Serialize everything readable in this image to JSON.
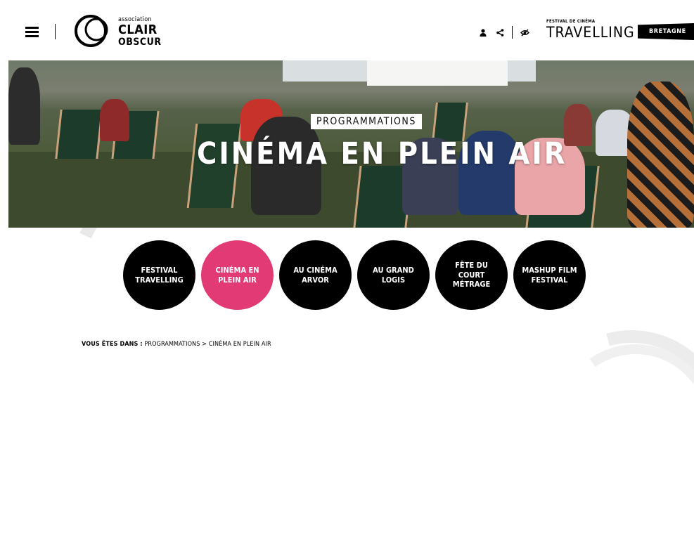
{
  "header": {
    "logo": {
      "small": "association",
      "line1": "CLAIR",
      "line2": "OBSCUR"
    },
    "icons": [
      "user-icon",
      "share-icon",
      "accessibility-icon"
    ],
    "festival": {
      "small": "FESTIVAL DE CINÉMA",
      "big": "TRAVELLING"
    },
    "region_logo": "BRETAGNE"
  },
  "hero": {
    "tag": "PROGRAMMATIONS",
    "title": "CINÉMA EN PLEIN AIR"
  },
  "nav": {
    "items": [
      {
        "label": "FESTIVAL TRAVELLING"
      },
      {
        "label": "CINÉMA EN PLEIN AIR"
      },
      {
        "label": "AU CINÉMA ARVOR"
      },
      {
        "label": "AU GRAND LOGIS"
      },
      {
        "label": "FÊTE DU COURT MÉTRAGE"
      },
      {
        "label": "MASHUP FILM FESTIVAL"
      }
    ],
    "active_color": "#e23a74"
  },
  "breadcrumb": {
    "label": "VOUS ÊTES DANS :",
    "parent": "PROGRAMMATIONS",
    "separator": ">",
    "current": "CINÉMA EN PLEIN AIR"
  }
}
